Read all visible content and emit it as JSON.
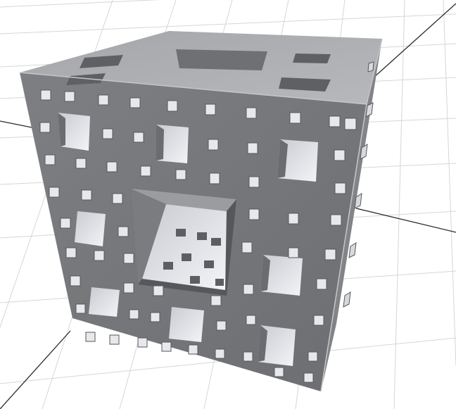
{
  "scene": {
    "object": "menger-sponge",
    "iteration_level": 3,
    "material_color": "#8a8c8f",
    "background_color": "#ffffff",
    "grid_color": "#d6d6d6",
    "axis_color": "#2a2a2a"
  }
}
